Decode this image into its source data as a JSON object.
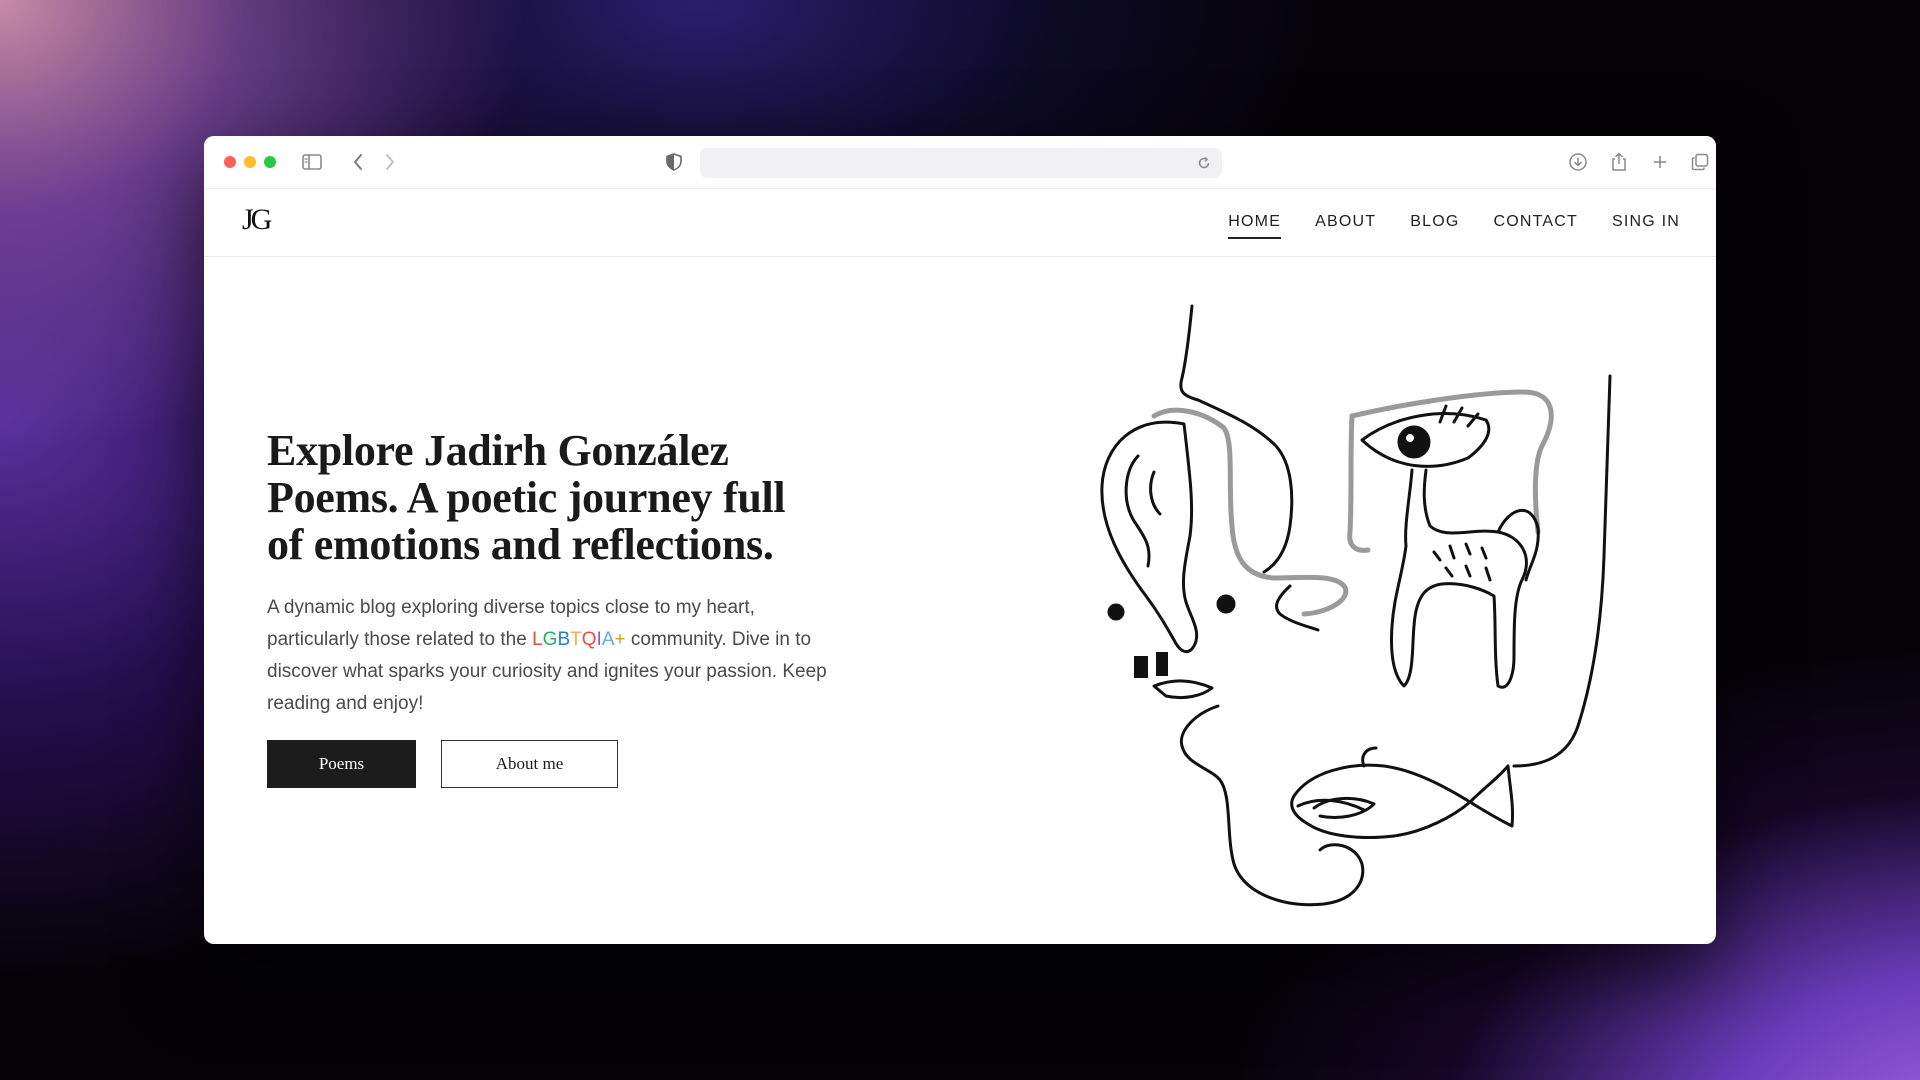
{
  "header": {
    "logo": "JG",
    "nav": [
      {
        "label": "HOME",
        "active": true
      },
      {
        "label": "ABOUT",
        "active": false
      },
      {
        "label": "BLOG",
        "active": false
      },
      {
        "label": "CONTACT",
        "active": false
      },
      {
        "label": "SING IN",
        "active": false
      }
    ]
  },
  "hero": {
    "title": "Explore Jadirh González Poems. A poetic journey full of emotions and reflections.",
    "desc_before": "A dynamic blog exploring diverse topics close to my heart, particularly those related to the ",
    "rainbow": [
      {
        "ch": "L",
        "color": "#e74c3c"
      },
      {
        "ch": "G",
        "color": "#27ae60"
      },
      {
        "ch": "B",
        "color": "#2d7dd2"
      },
      {
        "ch": "T",
        "color": "#f5b041"
      },
      {
        "ch": "Q",
        "color": "#e74c3c"
      },
      {
        "ch": "I",
        "color": "#9b59b6"
      },
      {
        "ch": "A",
        "color": "#5dade2"
      },
      {
        "ch": "+",
        "color": "#d4a017"
      }
    ],
    "desc_after": " community. Dive in to discover what sparks your curiosity and ignites your passion. Keep reading and enjoy!",
    "primary_button": "Poems",
    "secondary_button": "About me"
  },
  "icons": {
    "toolbar": [
      "sidebar-icon",
      "back-icon",
      "forward-icon",
      "shield-icon",
      "reload-icon",
      "download-icon",
      "share-icon",
      "new-tab-icon",
      "tabs-icon"
    ]
  }
}
